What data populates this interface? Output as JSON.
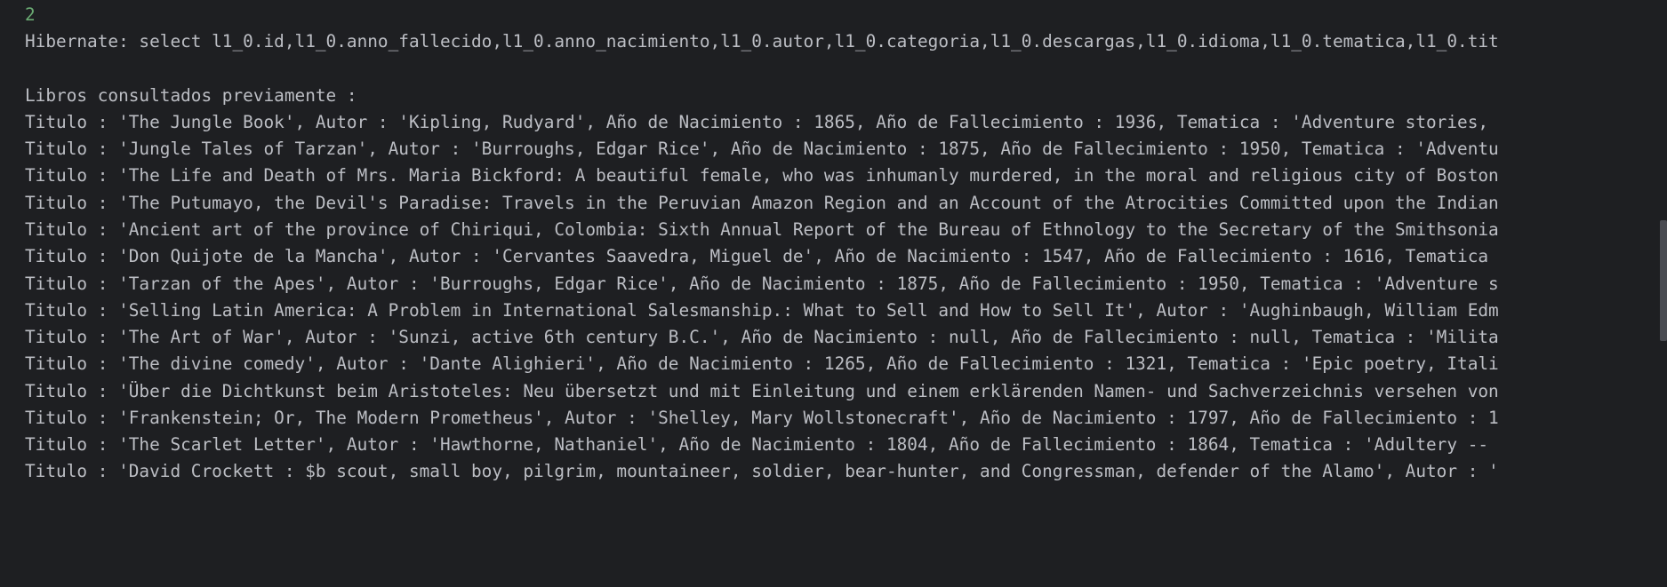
{
  "console": {
    "input_value": "2",
    "hibernate_query": "Hibernate: select l1_0.id,l1_0.anno_fallecido,l1_0.anno_nacimiento,l1_0.autor,l1_0.categoria,l1_0.descargas,l1_0.idioma,l1_0.tematica,l1_0.tit",
    "section_header": "Libros consultados previamente :",
    "book_lines": [
      "Titulo : 'The Jungle Book', Autor : 'Kipling, Rudyard', Año de Nacimiento : 1865, Año de Fallecimiento : 1936, Tematica : 'Adventure stories,",
      "Titulo : 'Jungle Tales of Tarzan', Autor : 'Burroughs, Edgar Rice', Año de Nacimiento : 1875, Año de Fallecimiento : 1950, Tematica : 'Adventu",
      "Titulo : 'The Life and Death of Mrs. Maria Bickford: A beautiful female, who was inhumanly murdered, in the moral and religious city of Boston",
      "Titulo : 'The Putumayo, the Devil's Paradise: Travels in the Peruvian Amazon Region and an Account of the Atrocities Committed upon the Indian",
      "Titulo : 'Ancient art of the province of Chiriqui, Colombia: Sixth Annual Report of the Bureau of Ethnology to the Secretary of the Smithsonia",
      "Titulo : 'Don Quijote de la Mancha', Autor : 'Cervantes Saavedra, Miguel de', Año de Nacimiento : 1547, Año de Fallecimiento : 1616, Tematica",
      "Titulo : 'Tarzan of the Apes', Autor : 'Burroughs, Edgar Rice', Año de Nacimiento : 1875, Año de Fallecimiento : 1950, Tematica : 'Adventure s",
      "Titulo : 'Selling Latin America: A Problem in International Salesmanship.: What to Sell and How to Sell It', Autor : 'Aughinbaugh, William Edm",
      "Titulo : 'The Art of War', Autor : 'Sunzi, active 6th century B.C.', Año de Nacimiento : null, Año de Fallecimiento : null, Tematica : 'Milita",
      "Titulo : 'The divine comedy', Autor : 'Dante Alighieri', Año de Nacimiento : 1265, Año de Fallecimiento : 1321, Tematica : 'Epic poetry, Itali",
      "Titulo : 'Über die Dichtkunst beim Aristoteles: Neu übersetzt und mit Einleitung und einem erklärenden Namen- und Sachverzeichnis versehen von",
      "Titulo : 'Frankenstein; Or, The Modern Prometheus', Autor : 'Shelley, Mary Wollstonecraft', Año de Nacimiento : 1797, Año de Fallecimiento : 1",
      "Titulo : 'The Scarlet Letter', Autor : 'Hawthorne, Nathaniel', Año de Nacimiento : 1804, Año de Fallecimiento : 1864, Tematica : 'Adultery --",
      "Titulo : 'David Crockett : $b scout, small boy, pilgrim, mountaineer, soldier, bear-hunter, and Congressman, defender of the Alamo', Autor : '"
    ]
  },
  "colors": {
    "background": "#1e1f22",
    "text": "#bcbec4",
    "input_text": "#6aab73",
    "scrollbar_thumb": "#4a4c52"
  }
}
